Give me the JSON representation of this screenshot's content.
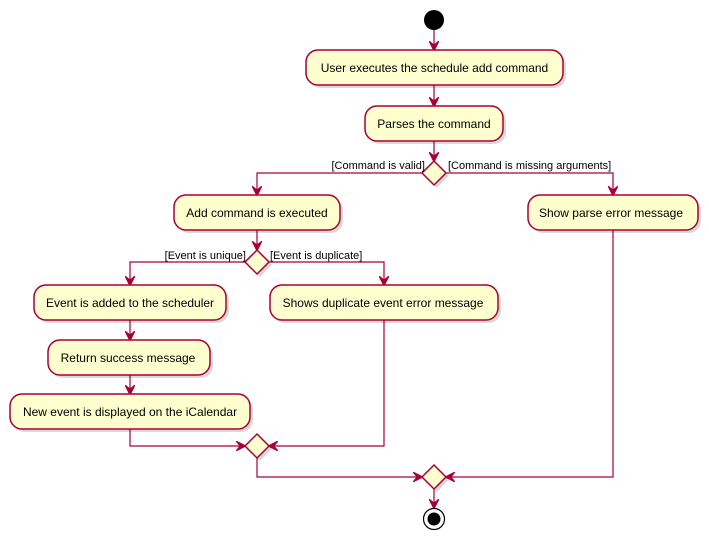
{
  "colors": {
    "fill": "#FEFECE",
    "stroke": "#A80036",
    "start": "#000000"
  },
  "nodes": {
    "user_executes": "User executes the schedule add command",
    "parses": "Parses the command",
    "add_executed": "Add command is executed",
    "parse_error": "Show parse error message",
    "event_added": "Event is added to the scheduler",
    "return_success": "Return success message",
    "new_event_displayed": "New event is displayed on the iCalendar",
    "duplicate_error": "Shows duplicate event error message"
  },
  "guards": {
    "command_valid": "[Command is valid]",
    "command_missing": "[Command is missing arguments]",
    "event_unique": "[Event is unique]",
    "event_duplicate": "[Event is duplicate]"
  }
}
